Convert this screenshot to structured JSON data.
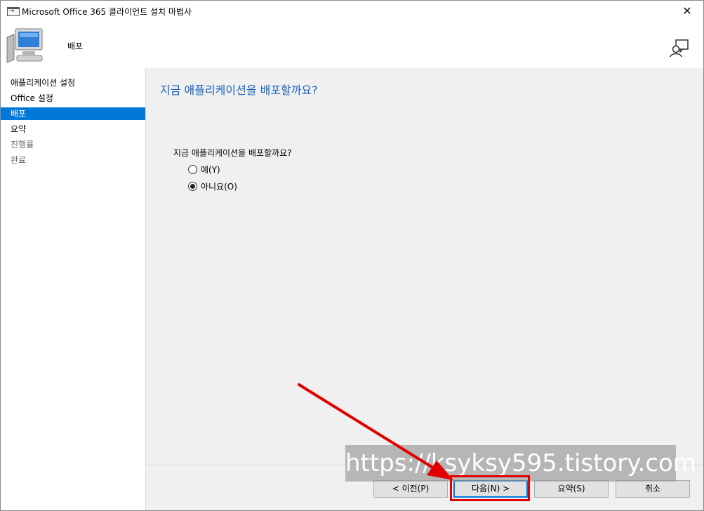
{
  "window": {
    "title": "Microsoft Office 365 클라이언트 설치 마법사",
    "close_glyph": "✕"
  },
  "header": {
    "title": "배포",
    "icons": [
      "computer-icon",
      "help-icon"
    ]
  },
  "sidebar": {
    "items": [
      {
        "label": "애플리케이션 설정",
        "state": "normal"
      },
      {
        "label": "Office 설정",
        "state": "normal"
      },
      {
        "label": "배포",
        "state": "active"
      },
      {
        "label": "요약",
        "state": "normal"
      },
      {
        "label": "진행률",
        "state": "disabled"
      },
      {
        "label": "완료",
        "state": "disabled"
      }
    ]
  },
  "main": {
    "heading": "지금 애플리케이션을 배포할까요?",
    "question": "지금 애플리케이션을 배포할까요?",
    "options": [
      {
        "label": "예(Y)",
        "selected": false
      },
      {
        "label": "아니요(O)",
        "selected": true
      }
    ]
  },
  "buttons": {
    "back": "< 이전(P)",
    "next": "다음(N) >",
    "summary": "요약(S)",
    "cancel": "취소"
  },
  "overlay": {
    "watermark": "https://ksyksy595.tistory.com",
    "annotation_color": "#e00000"
  },
  "colors": {
    "accent": "#0078d7",
    "heading": "#1a63b8",
    "content_bg": "#f0f0f0"
  }
}
